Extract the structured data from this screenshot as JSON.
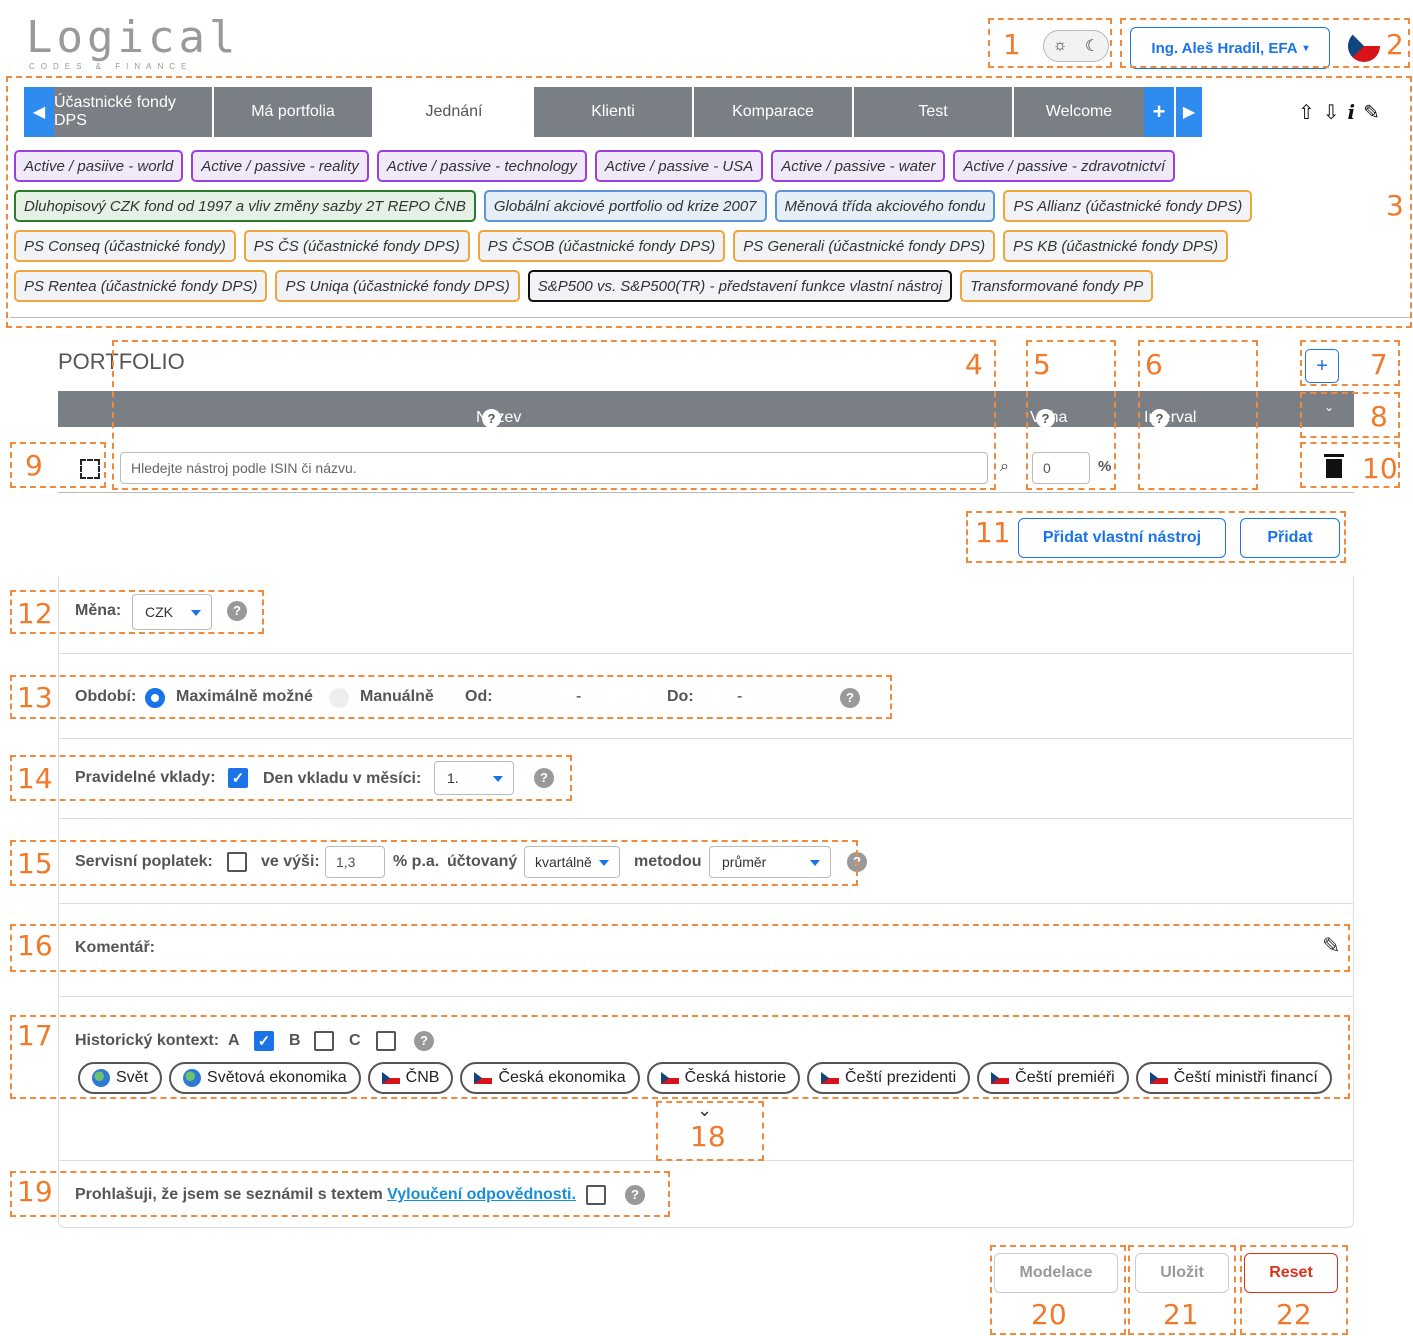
{
  "logo": {
    "main": "Logical",
    "sub": "CODES & FINANCE"
  },
  "header": {
    "user_label": "Ing. Aleš Hradil, EFA",
    "theme_icons": [
      "sun-icon",
      "moon-icon"
    ]
  },
  "tabs": [
    {
      "label": "Účastnické fondy DPS"
    },
    {
      "label": "Má portfolia"
    },
    {
      "label": "Jednání"
    },
    {
      "label": "Klienti"
    },
    {
      "label": "Komparace"
    },
    {
      "label": "Test"
    },
    {
      "label": "Welcome"
    }
  ],
  "chips": [
    [
      "Active / pasiive - world",
      "Active / passive - reality",
      "Active / passive - technology",
      "Active / passive - USA",
      "Active / passive - water",
      "Active / passive - zdravotnictví"
    ],
    [
      "Dluhopisový CZK fond od 1997 a vliv změny sazby 2T REPO ČNB",
      "Globální akciové portfolio od krize 2007",
      "Měnová třída akciového fondu",
      "PS Allianz (účastnické fondy DPS)"
    ],
    [
      "PS Conseq (účastnické fondy)",
      "PS ČS (účastnické fondy DPS)",
      "PS ČSOB (účastnické fondy DPS)",
      "PS Generali (účastnické fondy DPS)",
      "PS KB (účastnické fondy DPS)"
    ],
    [
      "PS Rentea (účastnické fondy DPS)",
      "PS Uniqa (účastnické fondy DPS)",
      "S&P500 vs. S&P500(TR) - představení funkce vlastní nástroj",
      "Transformované fondy PP"
    ]
  ],
  "portfolio": {
    "title": "PORTFOLIO",
    "col_name": "Název nástroje",
    "col_weight": "Váha",
    "col_interval": "Interval dat",
    "search_placeholder": "Hledejte nástroj podle ISIN či názvu.",
    "weight_value": "0",
    "percent": "%",
    "add_custom": "Přidat vlastní nástroj",
    "add": "Přidat"
  },
  "form": {
    "currency_label": "Měna:",
    "currency_value": "CZK",
    "period_label": "Období:",
    "period_max": "Maximálně možné",
    "period_manual": "Manuálně",
    "from_label": "Od:",
    "from_value": "-",
    "to_label": "Do:",
    "to_value": "-",
    "deposits_label": "Pravidelné vklady:",
    "deposit_day_label": "Den vkladu v měsíci:",
    "deposit_day_value": "1.",
    "fee_label": "Servisní poplatek:",
    "fee_amount_label": "ve výši:",
    "fee_value": "1,3",
    "fee_unit": "% p.a.",
    "fee_billed_label": "účtovaný",
    "fee_billed_value": "kvartálně",
    "fee_method_label": "metodou",
    "fee_method_value": "průměr",
    "comment_label": "Komentář:",
    "history_label": "Historický kontext:",
    "history_a": "A",
    "history_b": "B",
    "history_c": "C",
    "history_pills": [
      "Svět",
      "Světová ekonomika",
      "ČNB",
      "Česká ekonomika",
      "Česká historie",
      "Čeští prezidenti",
      "Čeští premiéři",
      "Čeští ministři financí"
    ],
    "disclaimer_text": "Prohlašuji, že jsem se seznámil s textem",
    "disclaimer_link": "Vyloučení odpovědnosti."
  },
  "actions": {
    "model": "Modelace",
    "save": "Uložit",
    "reset": "Reset"
  },
  "annotations": [
    "1",
    "2",
    "3",
    "4",
    "5",
    "6",
    "7",
    "8",
    "9",
    "10",
    "11",
    "12",
    "13",
    "14",
    "15",
    "16",
    "17",
    "18",
    "19",
    "20",
    "21",
    "22"
  ],
  "colors": {
    "accent": "#1a73e8",
    "tab_grey": "#7a7f85",
    "annotation": "#f08a3c",
    "reset": "#d9341a"
  }
}
